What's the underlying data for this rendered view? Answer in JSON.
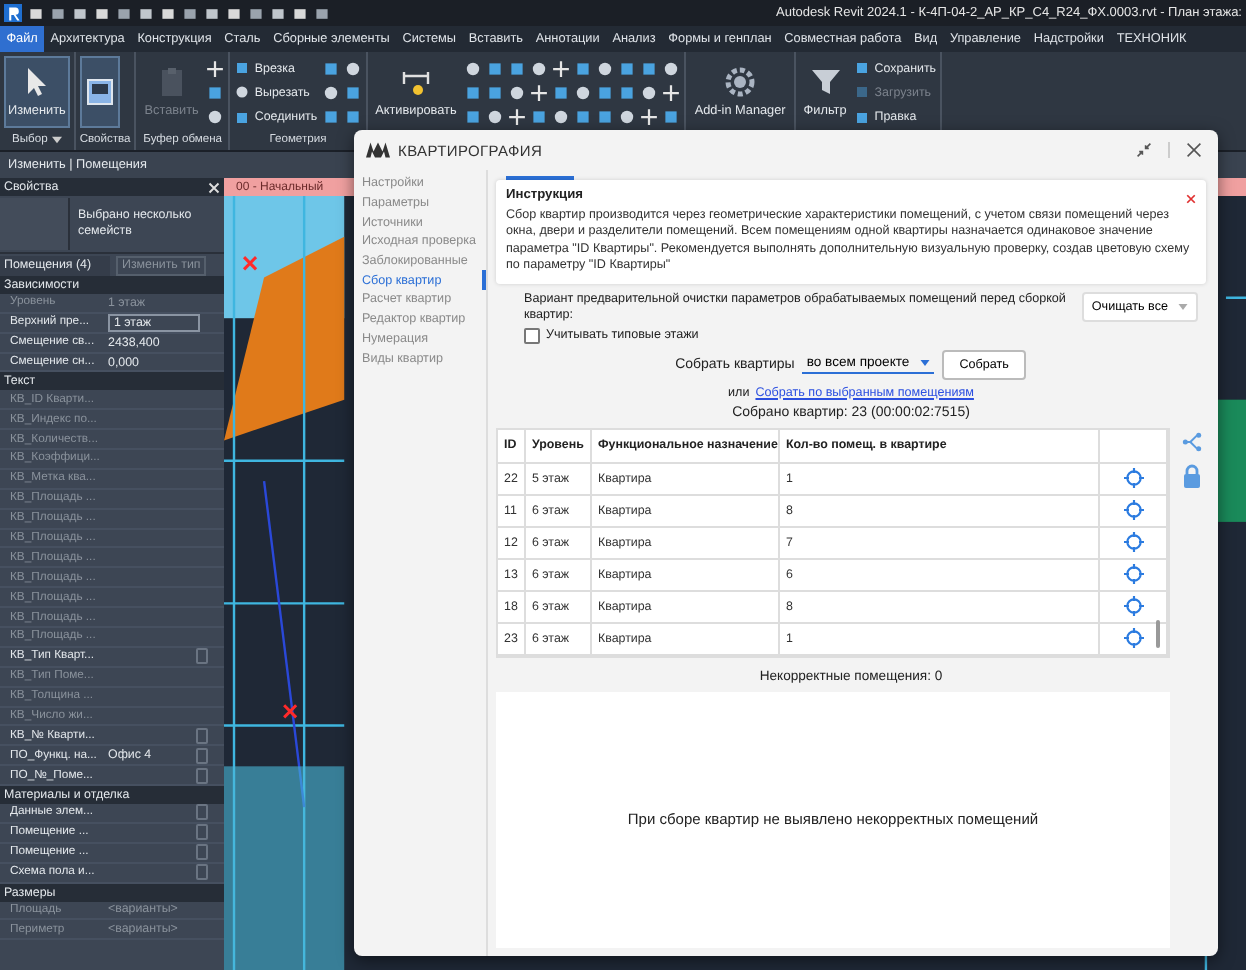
{
  "app": {
    "title": "Autodesk Revit 2024.1 - К-4П-04-2_АР_КР_С4_R24_ФХ.0003.rvt - План этажа:"
  },
  "menu_tabs": [
    {
      "label": "Файл",
      "selected": true
    },
    {
      "label": "Архитектура",
      "selected": false
    },
    {
      "label": "Конструкция",
      "selected": false
    },
    {
      "label": "Сталь",
      "selected": false
    },
    {
      "label": "Сборные элементы",
      "selected": false
    },
    {
      "label": "Системы",
      "selected": false
    },
    {
      "label": "Вставить",
      "selected": false
    },
    {
      "label": "Аннотации",
      "selected": false
    },
    {
      "label": "Анализ",
      "selected": false
    },
    {
      "label": "Формы и генплан",
      "selected": false
    },
    {
      "label": "Совместная работа",
      "selected": false
    },
    {
      "label": "Вид",
      "selected": false
    },
    {
      "label": "Управление",
      "selected": false
    },
    {
      "label": "Надстройки",
      "selected": false
    },
    {
      "label": "ТЕХНОНИК",
      "selected": false
    }
  ],
  "ribbon": {
    "panels": [
      {
        "label": "Выбор",
        "dropdown": true,
        "items": [
          {
            "kind": "large",
            "label": "Изменить",
            "disabled": false,
            "selected": true
          }
        ]
      },
      {
        "label": "Свойства",
        "dropdown": false,
        "items": [
          {
            "kind": "icon",
            "selected": true
          }
        ]
      },
      {
        "label": "Буфер обмена",
        "dropdown": false,
        "items": [
          {
            "kind": "large",
            "label": "Вставить",
            "disabled": true,
            "selected": false
          }
        ]
      },
      {
        "label": "Геометрия",
        "dropdown": false,
        "items": [
          {
            "kind": "small",
            "label": "Врезка",
            "disabled": false
          },
          {
            "kind": "small",
            "label": "Вырезать",
            "disabled": false
          },
          {
            "kind": "small",
            "label": "Соединить",
            "disabled": false
          }
        ]
      },
      {
        "dropdown": false,
        "items": [
          {
            "kind": "large",
            "label": "Активировать",
            "disabled": false,
            "selected": false
          }
        ]
      },
      {
        "dropdown": false,
        "items": [
          {
            "kind": "large",
            "label": "Add-in Manager",
            "disabled": false,
            "selected": false
          }
        ]
      },
      {
        "dropdown": false,
        "items": [
          {
            "kind": "large",
            "label": "Фильтр",
            "disabled": false,
            "selected": false
          },
          {
            "kind": "small",
            "label": "Сохранить",
            "disabled": false
          },
          {
            "kind": "small",
            "label": "Загрузить",
            "disabled": true
          },
          {
            "kind": "small",
            "label": "Правка",
            "disabled": false
          }
        ]
      }
    ]
  },
  "context_bar": {
    "label": "Изменить | Помещения"
  },
  "properties": {
    "title": "Свойства",
    "type": "Выбрано несколько семейств",
    "filter": "Помещения (4)",
    "edit_type": "Изменить тип",
    "sections": [
      {
        "title": "Зависимости",
        "rows": [
          {
            "kind": "text",
            "name": "Уровень",
            "value": "1 этаж",
            "disabled": true
          },
          {
            "kind": "field",
            "name": "Верхний пре...",
            "value": "1 этаж",
            "disabled": false
          },
          {
            "kind": "text",
            "name": "Смещение св...",
            "value": "2438,400",
            "disabled": false
          },
          {
            "kind": "text",
            "name": "Смещение сн...",
            "value": "0,000",
            "disabled": false
          }
        ]
      },
      {
        "title": "Текст",
        "rows": [
          {
            "kind": "text",
            "name": "КВ_ID Кварти...",
            "disabled": true
          },
          {
            "kind": "text",
            "name": "КВ_Индекс по...",
            "disabled": true
          },
          {
            "kind": "text",
            "name": "КВ_Количеств...",
            "disabled": true
          },
          {
            "kind": "text",
            "name": "КВ_Коэффици...",
            "disabled": true
          },
          {
            "kind": "text",
            "name": "КВ_Метка ква...",
            "disabled": true
          },
          {
            "kind": "text",
            "name": "КВ_Площадь ...",
            "disabled": true
          },
          {
            "kind": "text",
            "name": "КВ_Площадь ...",
            "disabled": true
          },
          {
            "kind": "text",
            "name": "КВ_Площадь ...",
            "disabled": true
          },
          {
            "kind": "text",
            "name": "КВ_Площадь ...",
            "disabled": true
          },
          {
            "kind": "text",
            "name": "КВ_Площадь ...",
            "disabled": true
          },
          {
            "kind": "text",
            "name": "КВ_Площадь ...",
            "disabled": true
          },
          {
            "kind": "text",
            "name": "КВ_Площадь ...",
            "disabled": true
          },
          {
            "kind": "text",
            "name": "КВ_Площадь ...",
            "disabled": true
          },
          {
            "kind": "checkbox",
            "name": "КВ_Тип Кварт...",
            "disabled": false,
            "checked": false
          },
          {
            "kind": "text",
            "name": "КВ_Тип Поме...",
            "disabled": true
          },
          {
            "kind": "text",
            "name": "КВ_Толщина ...",
            "disabled": true
          },
          {
            "kind": "text",
            "name": "КВ_Число жи...",
            "disabled": true
          },
          {
            "kind": "checkbox",
            "name": "КВ_№ Кварти...",
            "disabled": false,
            "checked": false
          },
          {
            "kind": "checkbox",
            "name": "ПО_Функц. на...",
            "value": "Офис 4",
            "disabled": false,
            "checked": false
          },
          {
            "kind": "checkbox",
            "name": "ПО_№_Поме...",
            "disabled": false,
            "checked": false
          }
        ]
      },
      {
        "title": "Материалы и отделка",
        "rows": [
          {
            "kind": "checkbox",
            "name": "Данные элем...",
            "disabled": false,
            "checked": false
          },
          {
            "kind": "checkbox",
            "name": "Помещение ...",
            "disabled": false,
            "checked": false
          },
          {
            "kind": "checkbox",
            "name": "Помещение ...",
            "disabled": false,
            "checked": false
          },
          {
            "kind": "checkbox",
            "name": "Схема пола и...",
            "disabled": false,
            "checked": false
          }
        ]
      },
      {
        "title": "Размеры",
        "rows": [
          {
            "kind": "text",
            "name": "Площадь",
            "value": "<варианты>",
            "disabled": true
          },
          {
            "kind": "text",
            "name": "Периметр",
            "value": "<варианты>",
            "disabled": true
          }
        ]
      }
    ]
  },
  "view_tab": {
    "label": "00 - Начальный"
  },
  "dialog": {
    "title": "КВАРТИРОГРАФИЯ",
    "nav": [
      {
        "label": "Настройки",
        "selected": false
      },
      {
        "label": "Параметры",
        "selected": false
      },
      {
        "label": "Источники",
        "selected": false
      },
      {
        "label": "Исходная проверка",
        "selected": false
      },
      {
        "label": "Заблокированные",
        "selected": false
      },
      {
        "label": "Сбор квартир",
        "selected": true
      },
      {
        "label": "Расчет квартир",
        "selected": false
      },
      {
        "label": "Редактор квартир",
        "selected": false
      },
      {
        "label": "Нумерация",
        "selected": false
      },
      {
        "label": "Виды квартир",
        "selected": false
      }
    ],
    "instruction": {
      "title": "Инструкция",
      "text": "Сбор квартир производится через геометрические характеристики помещений, с учетом связи помещений через окна, двери и разделители помещений. Всем помещениям одной квартиры назначается одинаковое значение параметра \"ID Квартиры\". Рекомендуется выполнять дополнительную визуальную проверку, создав цветовую схему по параметру \"ID Квартиры\""
    },
    "cleanup": {
      "label": "Вариант предварительной очистки параметров обрабатываемых помещений перед сборкой квартир:",
      "value": "Очищать все"
    },
    "typical_floors": {
      "label": "Учитывать типовые этажи",
      "checked": false
    },
    "collect": {
      "label": "Собрать квартиры",
      "scope": "во всем проекте",
      "button": "Собрать"
    },
    "alt": {
      "prefix": "или",
      "link": "Собрать по выбранным помещениям"
    },
    "summary": "Собрано квартир: 23 (00:00:02:7515)",
    "table": {
      "columns": [
        "ID",
        "Уровень",
        "Функциональное назначение",
        "Кол-во помещ. в квартире"
      ],
      "rows": [
        [
          "22",
          "5 этаж",
          "Квартира",
          "1"
        ],
        [
          "11",
          "6 этаж",
          "Квартира",
          "8"
        ],
        [
          "12",
          "6 этаж",
          "Квартира",
          "7"
        ],
        [
          "13",
          "6 этаж",
          "Квартира",
          "6"
        ],
        [
          "18",
          "6 этаж",
          "Квартира",
          "8"
        ],
        [
          "23",
          "6 этаж",
          "Квартира",
          "1"
        ]
      ]
    },
    "errors": {
      "title": "Некорректные помещения: 0",
      "message": "При сборе квартир не выявлено некорректных помещений"
    }
  }
}
